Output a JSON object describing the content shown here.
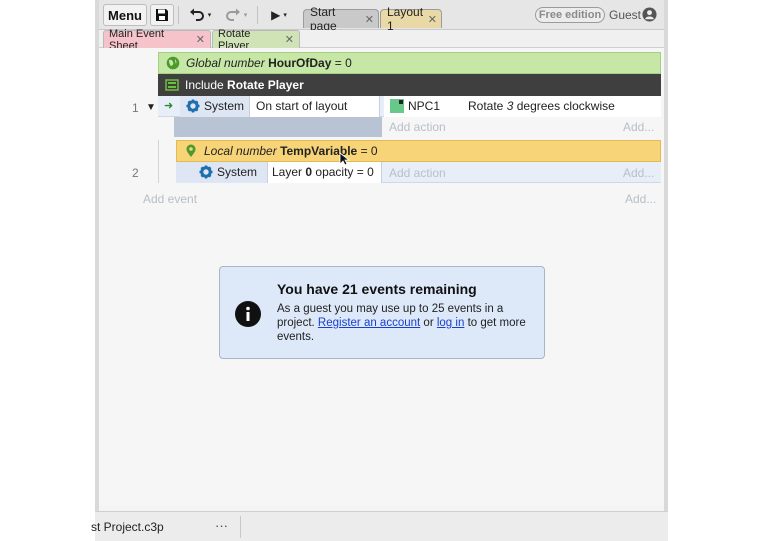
{
  "toolbar": {
    "menu_label": "Menu",
    "free_badge": "Free edition",
    "guest_label": "Guest",
    "tabs": [
      {
        "label": "Start page",
        "close": "✕"
      },
      {
        "label": "Layout 1",
        "close": "✕"
      }
    ],
    "icons": {
      "save": "save-icon",
      "undo": "undo-icon",
      "redo": "redo-icon",
      "play": "play-icon",
      "avatar": "user-avatar-icon"
    },
    "caret": "▾",
    "play_glyph": "▶"
  },
  "sheet_tabs": [
    {
      "label": "Main Event Sheet",
      "close": "✕",
      "color": "#f5c3c9"
    },
    {
      "label": "Rotate Player",
      "close": "✕",
      "color": "#cfe3b6"
    }
  ],
  "events": {
    "global_var": {
      "prefix": "Global number",
      "name": "HourOfDay",
      "suffix": "= 0"
    },
    "include": {
      "prefix": "Include",
      "name": "Rotate Player"
    },
    "event1": {
      "number": "1",
      "toggle": "▼",
      "arrow": "➜",
      "condition_object": "System",
      "condition_text": "On start of layout",
      "action_object": "NPC1",
      "action_text_pre": "Rotate",
      "action_value": "3",
      "action_text_post": "degrees clockwise",
      "add_action": "Add action",
      "add_more": "Add..."
    },
    "local_var": {
      "prefix": "Local number",
      "name": "TempVariable",
      "suffix": "= 0"
    },
    "event2": {
      "number": "2",
      "condition_object": "System",
      "condition_pre": "Layer",
      "condition_value": "0",
      "condition_post": "opacity = 0",
      "add_action": "Add action",
      "add_more": "Add..."
    },
    "add_event": "Add event",
    "add_event_more": "Add..."
  },
  "info": {
    "title": "You have 21 events remaining",
    "body_pre": "As a guest you may use up to 25 events in a project.",
    "link_register": "Register an account",
    "middle": "or",
    "link_login": "log in",
    "body_post": "to get more events."
  },
  "statusbar": {
    "file_name": "st Project.c3p",
    "more": "···"
  },
  "colors": {
    "global_bg": "#c6e7a6",
    "include_bg": "#3f3f3f",
    "local_bg": "#f7d477",
    "event_bg": "#e7eef8",
    "info_bg": "#dde8f9",
    "link": "#1a3fcf",
    "sprite": "#66c98a"
  }
}
